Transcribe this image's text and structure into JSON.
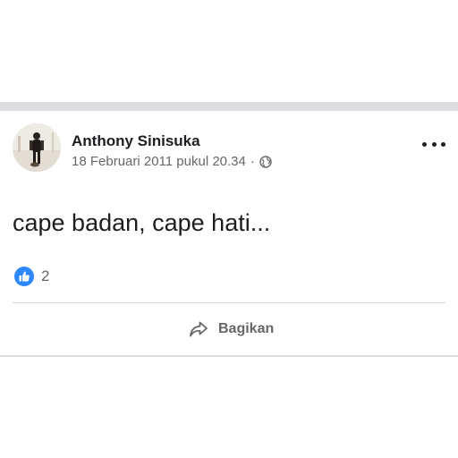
{
  "post": {
    "author": "Anthony Sinisuka",
    "date": "18 Februari 2011 pukul 20.34",
    "separator": "·",
    "privacy_icon": "globe-icon",
    "text": "cape badan, cape hati...",
    "reactions": {
      "icon": "like-icon",
      "count": "2"
    },
    "actions": {
      "share_label": "Bagikan",
      "share_icon": "share-icon"
    },
    "more_icon": "more-options-icon"
  },
  "colors": {
    "background": "#ffffff",
    "divider": "#dcdde1",
    "text_primary": "#1c1e21",
    "text_secondary": "#65676b",
    "like_blue": "#2d88ff"
  }
}
